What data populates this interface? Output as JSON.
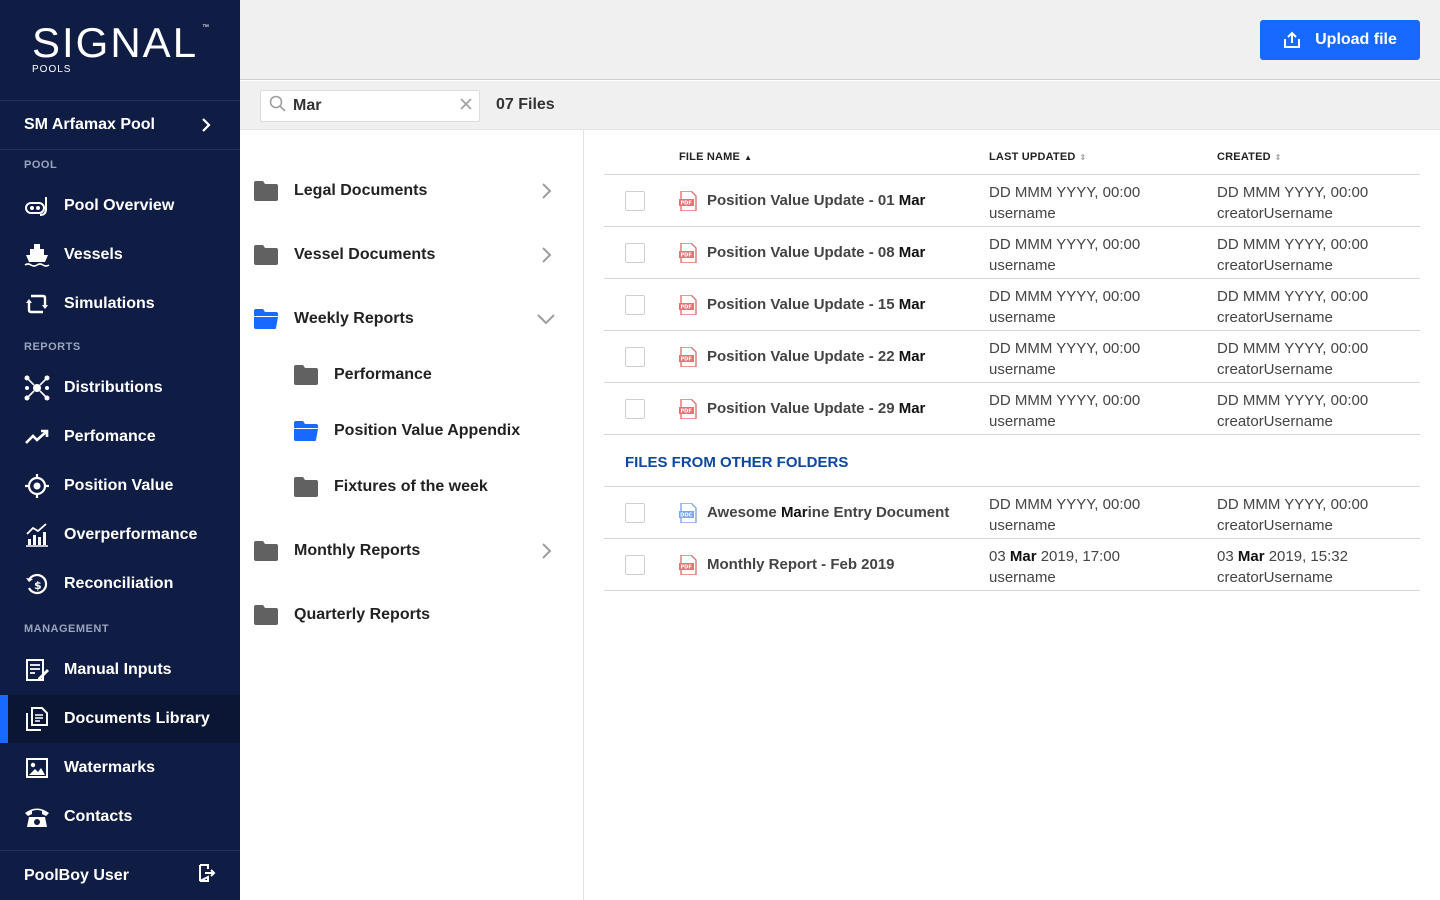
{
  "brand": {
    "name": "SIGNAL",
    "tm": "™",
    "sub": "POOLS"
  },
  "pool_selector": {
    "label": "SM Arfamax Pool"
  },
  "sections": {
    "pool": "POOL",
    "reports": "REPORTS",
    "management": "MANAGEMENT"
  },
  "nav": {
    "pool_overview": "Pool Overview",
    "vessels": "Vessels",
    "simulations": "Simulations",
    "distributions": "Distributions",
    "performance": "Perfomance",
    "position_value": "Position Value",
    "overperformance": "Overperformance",
    "reconciliation": "Reconciliation",
    "manual_inputs": "Manual Inputs",
    "documents_library": "Documents Library",
    "watermarks": "Watermarks",
    "contacts": "Contacts"
  },
  "footer": {
    "user": "PoolBoy User"
  },
  "toolbar": {
    "upload_label": "Upload file"
  },
  "search": {
    "value": "Mar",
    "placeholder": "",
    "count": "07 Files"
  },
  "folders": {
    "legal": "Legal Documents",
    "vessel": "Vessel Documents",
    "weekly": "Weekly Reports",
    "weekly_performance": "Performance",
    "weekly_position_value": "Position Value Appendix",
    "weekly_fixtures": "Fixtures of the week",
    "monthly": "Monthly Reports",
    "quarterly": "Quarterly Reports"
  },
  "table": {
    "headers": {
      "file_name": "FILE NAME",
      "last_updated": "LAST UPDATED",
      "created": "CREATED"
    },
    "rows": [
      {
        "name_prefix": "Position Value Update - 01 ",
        "name_match": "Mar",
        "updated_date": "DD MMM YYYY, 00:00",
        "updated_user": "username",
        "created_date": "DD MMM YYYY, 00:00",
        "created_user": "creatorUsername"
      },
      {
        "name_prefix": "Position Value Update - 08 ",
        "name_match": "Mar",
        "updated_date": "DD MMM YYYY, 00:00",
        "updated_user": "username",
        "created_date": "DD MMM YYYY, 00:00",
        "created_user": "creatorUsername"
      },
      {
        "name_prefix": "Position Value Update - 15 ",
        "name_match": "Mar",
        "updated_date": "DD MMM YYYY, 00:00",
        "updated_user": "username",
        "created_date": "DD MMM YYYY, 00:00",
        "created_user": "creatorUsername"
      },
      {
        "name_prefix": "Position Value Update - 22 ",
        "name_match": "Mar",
        "updated_date": "DD MMM YYYY, 00:00",
        "updated_user": "username",
        "created_date": "DD MMM YYYY, 00:00",
        "created_user": "creatorUsername"
      },
      {
        "name_prefix": "Position Value Update - 29 ",
        "name_match": "Mar",
        "updated_date": "DD MMM YYYY, 00:00",
        "updated_user": "username",
        "created_date": "DD MMM YYYY, 00:00",
        "created_user": "creatorUsername"
      }
    ],
    "other_header": "FILES FROM OTHER FOLDERS",
    "other_rows": [
      {
        "name_prefix": "Awesome ",
        "name_match": "Mar",
        "name_suffix": "ine Entry Document",
        "updated_date": "DD MMM YYYY, 00:00",
        "updated_user": "username",
        "created_date": "DD MMM YYYY, 00:00",
        "created_user": "creatorUsername"
      },
      {
        "name_full": "Monthly Report - Feb 2019",
        "updated_pre": "03 ",
        "updated_match": "Mar",
        "updated_post": " 2019, 17:00",
        "updated_user": "username",
        "created_pre": "03 ",
        "created_match": "Mar",
        "created_post": " 2019, 15:32",
        "created_user": "creatorUsername"
      }
    ]
  },
  "colors": {
    "sidebar": "#0f1d44",
    "accent": "#1769ff",
    "pdf": "#e57373",
    "doc": "#7fa7e8",
    "folder": "#616161",
    "link": "#0d47a1"
  }
}
